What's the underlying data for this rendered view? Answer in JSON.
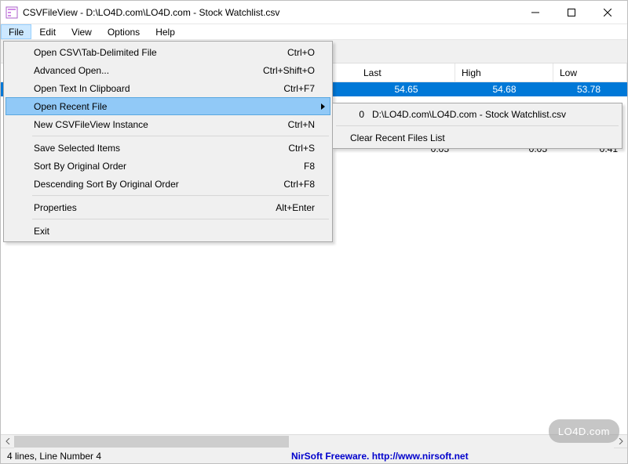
{
  "title": "CSVFileView  -  D:\\LO4D.com\\LO4D.com - Stock Watchlist.csv",
  "menubar": [
    "File",
    "Edit",
    "View",
    "Options",
    "Help"
  ],
  "columns": {
    "last": "Last",
    "high": "High",
    "low": "Low"
  },
  "rows": [
    {
      "last": "54.65",
      "high": "54.68",
      "low": "53.78",
      "selected": true
    },
    {
      "last": "0.05",
      "high": "0.05",
      "low": "0.41",
      "selected": false
    }
  ],
  "file_menu": {
    "open_csv": {
      "label": "Open CSV\\Tab-Delimited  File",
      "shortcut": "Ctrl+O"
    },
    "advanced_open": {
      "label": "Advanced Open...",
      "shortcut": "Ctrl+Shift+O"
    },
    "open_clipboard": {
      "label": "Open Text In Clipboard",
      "shortcut": "Ctrl+F7"
    },
    "open_recent": {
      "label": "Open Recent File",
      "shortcut": ""
    },
    "new_instance": {
      "label": "New CSVFileView Instance",
      "shortcut": "Ctrl+N"
    },
    "save_selected": {
      "label": "Save Selected Items",
      "shortcut": "Ctrl+S"
    },
    "sort_original": {
      "label": "Sort By Original Order",
      "shortcut": "F8"
    },
    "sort_desc": {
      "label": "Descending Sort By Original Order",
      "shortcut": "Ctrl+F8"
    },
    "properties": {
      "label": "Properties",
      "shortcut": "Alt+Enter"
    },
    "exit": {
      "label": "Exit",
      "shortcut": ""
    }
  },
  "recent_submenu": {
    "item0_index": "0",
    "item0_label": "D:\\LO4D.com\\LO4D.com - Stock Watchlist.csv",
    "clear": "Clear Recent Files List"
  },
  "status": {
    "left": "4 lines, Line Number 4",
    "link": "NirSoft Freeware.  http://www.nirsoft.net"
  },
  "watermark": "LO4D.com"
}
